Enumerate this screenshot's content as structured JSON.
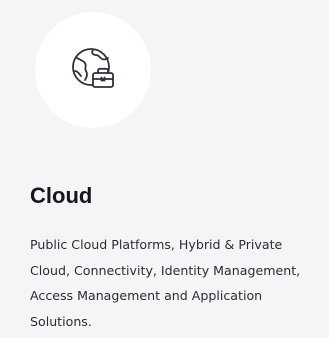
{
  "card": {
    "icon": "globe-briefcase-icon",
    "title": "Cloud",
    "description": "Public Cloud Platforms, Hybrid & Private Cloud, Connectivity, Identity Management, Access Management and Application Solutions."
  },
  "colors": {
    "card_background": "#f3f5f7",
    "icon_circle": "#ffffff",
    "icon_stroke": "#2f3138",
    "title_text": "#15171c",
    "body_text": "#2b2d33"
  }
}
